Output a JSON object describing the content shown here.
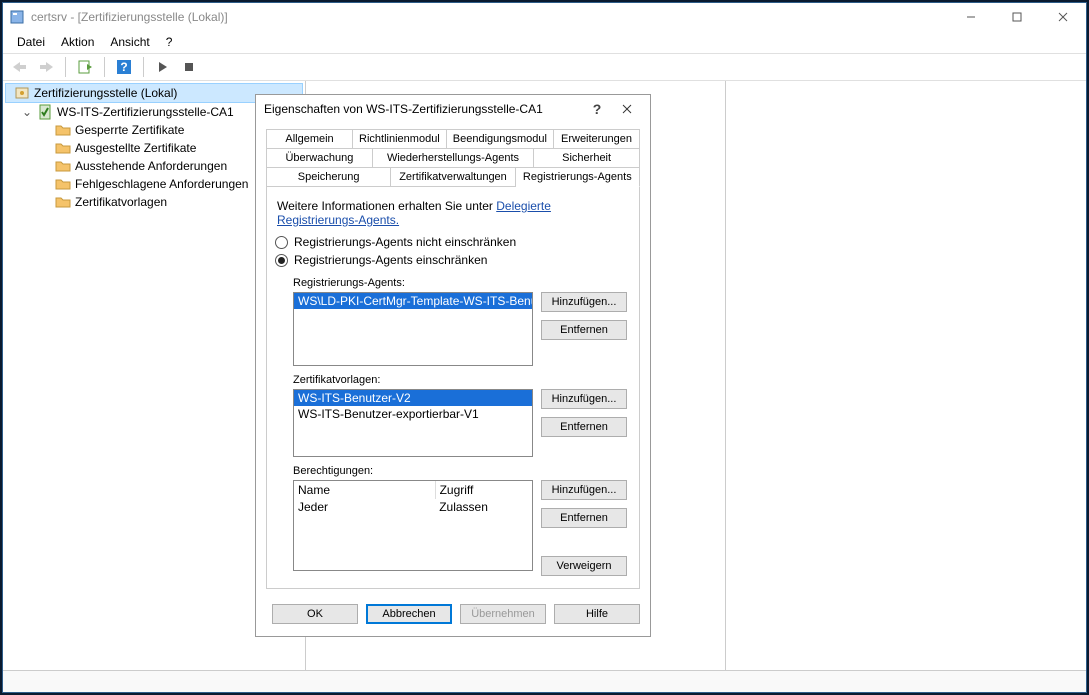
{
  "titlebar": {
    "text": "certsrv - [Zertifizierungsstelle (Lokal)]"
  },
  "menu": {
    "file": "Datei",
    "action": "Aktion",
    "view": "Ansicht",
    "help": "?"
  },
  "tree": {
    "root": "Zertifizierungsstelle (Lokal)",
    "ca": "WS-ITS-Zertifizierungsstelle-CA1",
    "children": [
      "Gesperrte Zertifikate",
      "Ausgestellte Zertifikate",
      "Ausstehende Anforderungen",
      "Fehlgeschlagene Anforderungen",
      "Zertifikatvorlagen"
    ]
  },
  "dialog": {
    "title": "Eigenschaften von WS-ITS-Zertifizierungsstelle-CA1",
    "tabs_row1": [
      "Allgemein",
      "Richtlinienmodul",
      "Beendigungsmodul",
      "Erweiterungen"
    ],
    "tabs_row2": [
      "Überwachung",
      "Wiederherstellungs-Agents",
      "Sicherheit"
    ],
    "tabs_row3": [
      "Speicherung",
      "Zertifikatverwaltungen",
      "Registrierungs-Agents"
    ],
    "info_prefix": "Weitere Informationen erhalten Sie unter ",
    "info_link": "Delegierte Registrierungs-Agents.",
    "radio1": "Registrierungs-Agents nicht einschränken",
    "radio2": "Registrierungs-Agents einschränken",
    "sec1_label": "Registrierungs-Agents:",
    "sec1_items": [
      "WS\\LD-PKI-CertMgr-Template-WS-ITS-Benutzer-"
    ],
    "sec2_label": "Zertifikatvorlagen:",
    "sec2_items": [
      "WS-ITS-Benutzer-V2",
      "WS-ITS-Benutzer-exportierbar-V1"
    ],
    "sec3_label": "Berechtigungen:",
    "perm_header": {
      "name": "Name",
      "access": "Zugriff"
    },
    "perm_rows": [
      {
        "name": "Jeder",
        "access": "Zulassen"
      }
    ],
    "btn_add": "Hinzufügen...",
    "btn_remove": "Entfernen",
    "btn_deny": "Verweigern",
    "btn_ok": "OK",
    "btn_cancel": "Abbrechen",
    "btn_apply": "Übernehmen",
    "btn_help": "Hilfe"
  }
}
